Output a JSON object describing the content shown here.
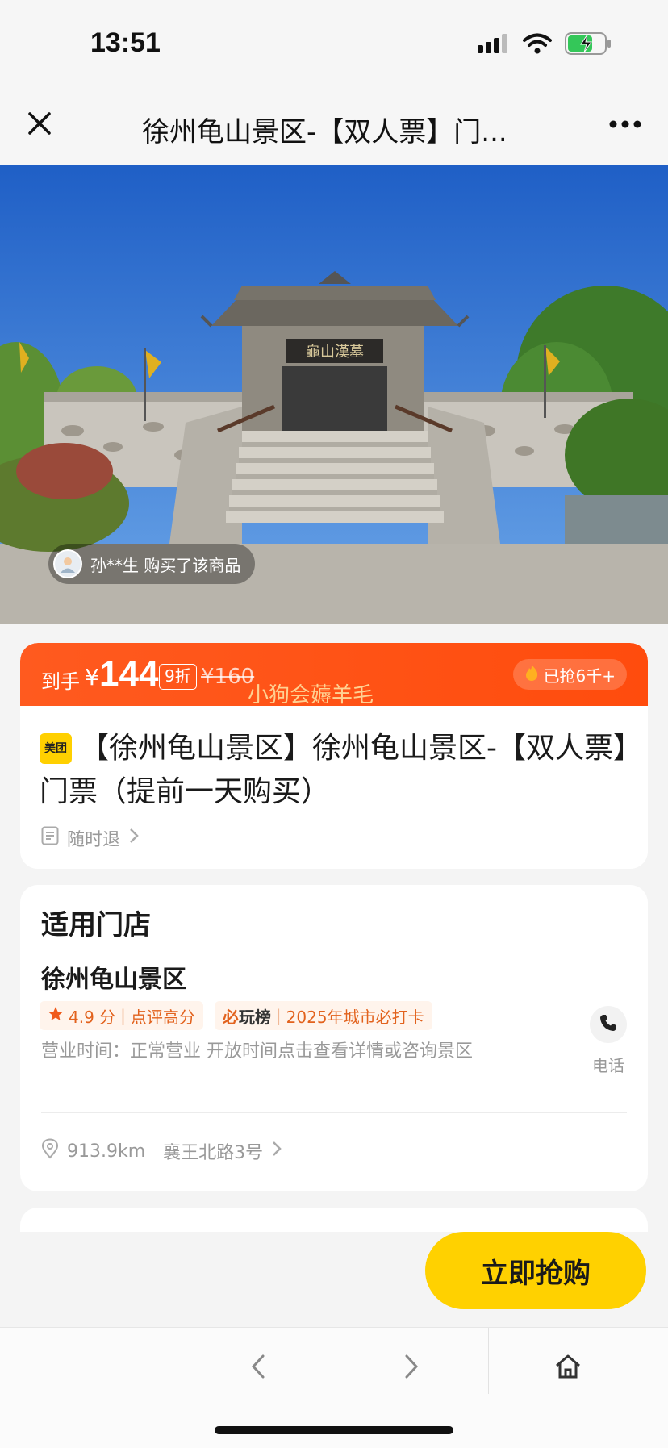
{
  "status_bar": {
    "time": "13:51",
    "icons": [
      "signal-icon",
      "wifi-icon",
      "battery-charging-icon"
    ]
  },
  "nav": {
    "title": "徐州龟山景区-【双人票】门...",
    "close_icon": "close-icon",
    "more_icon": "more-icon"
  },
  "hero": {
    "buyer_text": "孙**生 购买了该商品",
    "plaque_text": "龜山漢墓"
  },
  "price": {
    "prefix": "到手",
    "currency": "¥",
    "value": "144",
    "discount": "9折",
    "original": "¥160",
    "watermark": "小狗会薅羊毛",
    "sold": "已抢6千+"
  },
  "product": {
    "brand_badge": "美团",
    "title": "【徐州龟山景区】徐州龟山景区-【双人票】门票（提前一天购买）",
    "refund_policy": "随时退"
  },
  "store": {
    "heading": "适用门店",
    "name": "徐州龟山景区",
    "rating": "4.9 分",
    "rating_note": "点评高分",
    "rank_logo_prefix": "必",
    "rank_logo_suffix": "玩榜",
    "rank_note": "2025年城市必打卡",
    "hours": "营业时间：正常营业 开放时间点击查看详情或咨询景区",
    "phone_label": "电话",
    "distance": "913.9km",
    "address": "襄王北路3号"
  },
  "actions": {
    "buy": "立即抢购"
  },
  "colors": {
    "accent_orange": "#ff5a1f",
    "buy_yellow": "#ffd100",
    "tag_text": "#e2621d"
  }
}
